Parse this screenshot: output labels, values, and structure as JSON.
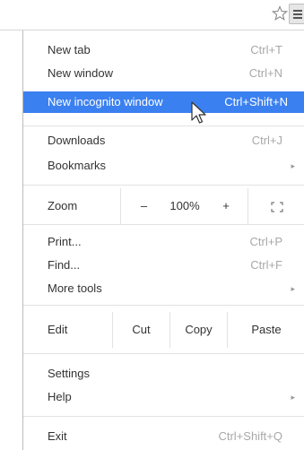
{
  "menu": {
    "new_tab": {
      "label": "New tab",
      "shortcut": "Ctrl+T"
    },
    "new_window": {
      "label": "New window",
      "shortcut": "Ctrl+N"
    },
    "new_incognito": {
      "label": "New incognito window",
      "shortcut": "Ctrl+Shift+N"
    },
    "downloads": {
      "label": "Downloads",
      "shortcut": "Ctrl+J"
    },
    "bookmarks": {
      "label": "Bookmarks",
      "submenu_glyph": "▸"
    },
    "zoom": {
      "label": "Zoom",
      "minus": "–",
      "value": "100%",
      "plus": "+"
    },
    "print": {
      "label": "Print...",
      "shortcut": "Ctrl+P"
    },
    "find": {
      "label": "Find...",
      "shortcut": "Ctrl+F"
    },
    "more_tools": {
      "label": "More tools",
      "submenu_glyph": "▸"
    },
    "edit": {
      "label": "Edit",
      "cut": "Cut",
      "copy": "Copy",
      "paste": "Paste"
    },
    "settings": {
      "label": "Settings"
    },
    "help": {
      "label": "Help",
      "submenu_glyph": "▸"
    },
    "exit": {
      "label": "Exit",
      "shortcut": "Ctrl+Shift+Q"
    }
  },
  "icons": {
    "star": "star-outline-icon",
    "menu": "hamburger-menu-icon",
    "fullscreen": "fullscreen-icon",
    "cursor": "mouse-pointer-icon"
  },
  "colors": {
    "highlight": "#3b80f0",
    "shortcut_text": "#a8a8a8",
    "separator": "#e2e2e2"
  }
}
